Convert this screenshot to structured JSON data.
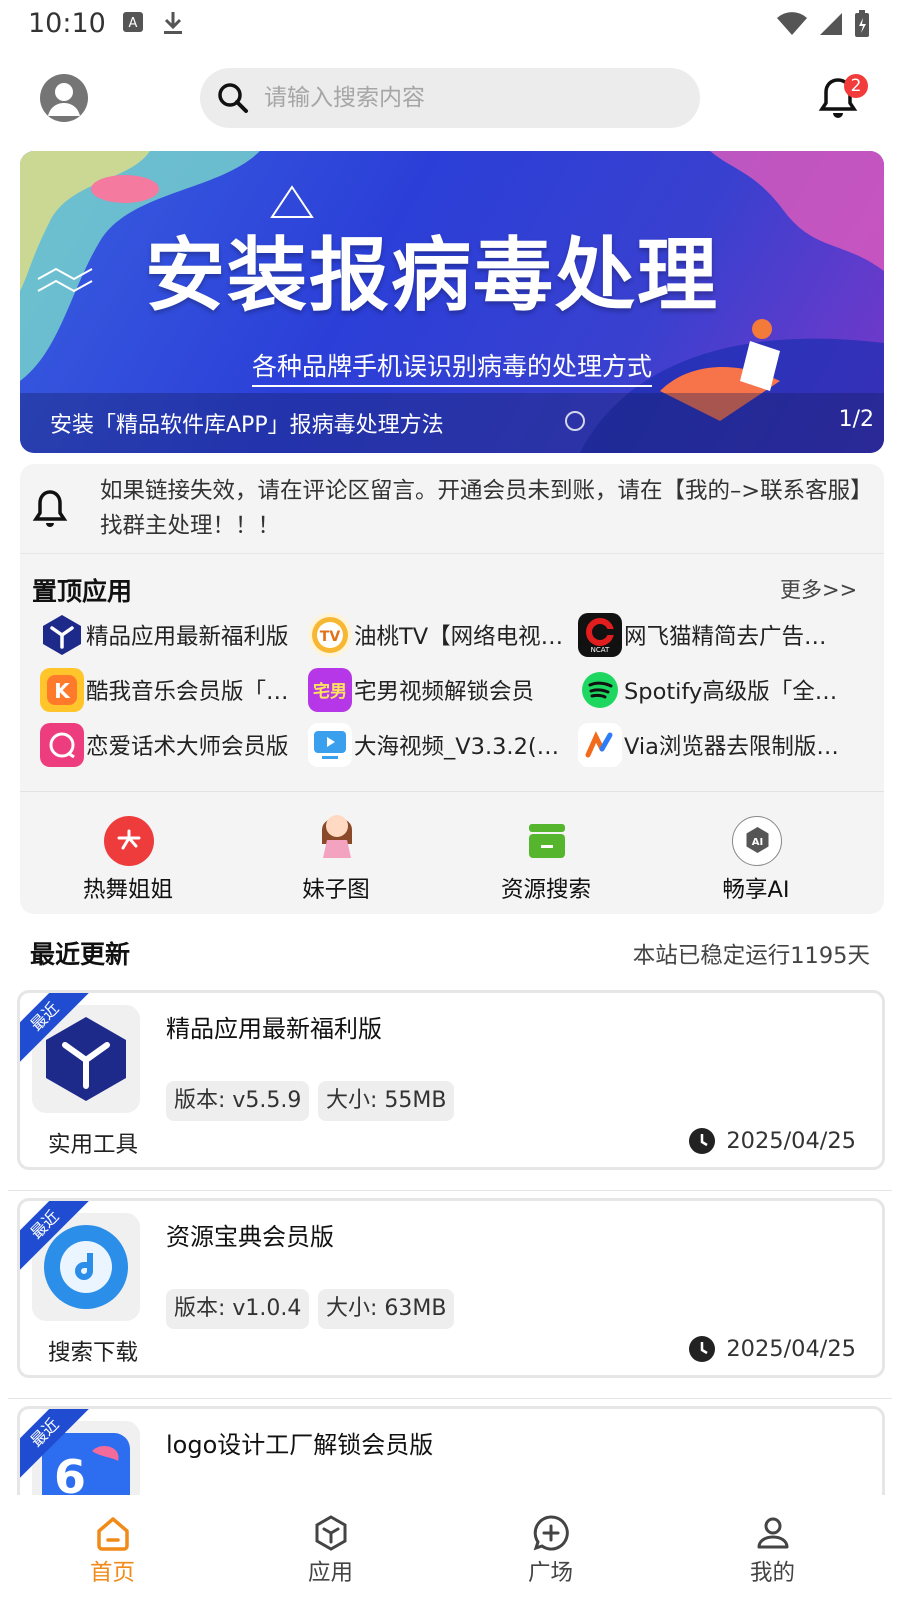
{
  "status_bar": {
    "time": "10:10"
  },
  "header": {
    "search_placeholder": "请输入搜索内容",
    "notification_count": "2"
  },
  "banner": {
    "headline": "安装报病毒处理",
    "subtitle": "各种品牌手机误识别病毒的处理方式",
    "caption": "安装「精品软件库APP」报病毒处理方法",
    "index": "1/2"
  },
  "notice": {
    "text": "如果链接失效，请在评论区留言。开通会员未到账，请在【我的–>联系客服】找群主处理！！！"
  },
  "pinned": {
    "title": "置顶应用",
    "more_label": "更多>>",
    "items": [
      {
        "label": "精品应用最新福利版",
        "icon": "cube-app-icon",
        "color": "#1e2a8a"
      },
      {
        "label": "油桃TV【网络电视…",
        "icon": "tv-app-icon",
        "color": "#f39a1f"
      },
      {
        "label": "网飞猫精简去广告…",
        "icon": "netflix-cat-app-icon",
        "color": "#e11d1d"
      },
      {
        "label": "酷我音乐会员版「…",
        "icon": "kuwo-music-app-icon",
        "color": "#ffb020"
      },
      {
        "label": "宅男视频解锁会员",
        "icon": "video-app-icon",
        "color": "#b637e8"
      },
      {
        "label": "Spotify高级版「全…",
        "icon": "spotify-icon",
        "color": "#1ed760"
      },
      {
        "label": "恋爱话术大师会员版",
        "icon": "love-chat-app-icon",
        "color": "#ee3d7f"
      },
      {
        "label": "大海视频_V3.3.2(33…",
        "icon": "sea-video-app-icon",
        "color": "#3aa0ee"
      },
      {
        "label": "Via浏览器去限制版…",
        "icon": "via-browser-icon",
        "color": "#f26b1d"
      }
    ]
  },
  "quick_links": [
    {
      "label": "热舞姐姐",
      "icon": "dance-icon",
      "color": "#ee3b3b"
    },
    {
      "label": "妹子图",
      "icon": "girl-avatar-icon",
      "color": "#e87a9a"
    },
    {
      "label": "资源搜索",
      "icon": "storage-box-icon",
      "color": "#55b52d"
    },
    {
      "label": "畅享AI",
      "icon": "ai-icon",
      "color": "#666666"
    }
  ],
  "recent": {
    "title": "最近更新",
    "uptime": "本站已稳定运行1195天",
    "ribbon_label": "最近",
    "cards": [
      {
        "name": "精品应用最新福利版",
        "version": "版本: v5.5.9",
        "size": "大小: 55MB",
        "category": "实用工具",
        "date": "2025/04/25",
        "icon": "cube-app-icon"
      },
      {
        "name": "资源宝典会员版",
        "version": "版本: v1.0.4",
        "size": "大小: 63MB",
        "category": "搜索下载",
        "date": "2025/04/25",
        "icon": "resource-app-icon"
      },
      {
        "name": "logo设计工厂解锁会员版",
        "version": "",
        "size": "",
        "category": "",
        "date": "",
        "icon": "logo-design-app-icon"
      }
    ]
  },
  "bottom_nav": [
    {
      "label": "首页",
      "icon": "home-icon",
      "active": true
    },
    {
      "label": "应用",
      "icon": "apps-cube-icon",
      "active": false
    },
    {
      "label": "广场",
      "icon": "plaza-chat-icon",
      "active": false
    },
    {
      "label": "我的",
      "icon": "profile-icon",
      "active": false
    }
  ],
  "colors": {
    "accent": "#f08a18",
    "ribbon": "#1f4cd1",
    "badge": "#f23b3b"
  }
}
